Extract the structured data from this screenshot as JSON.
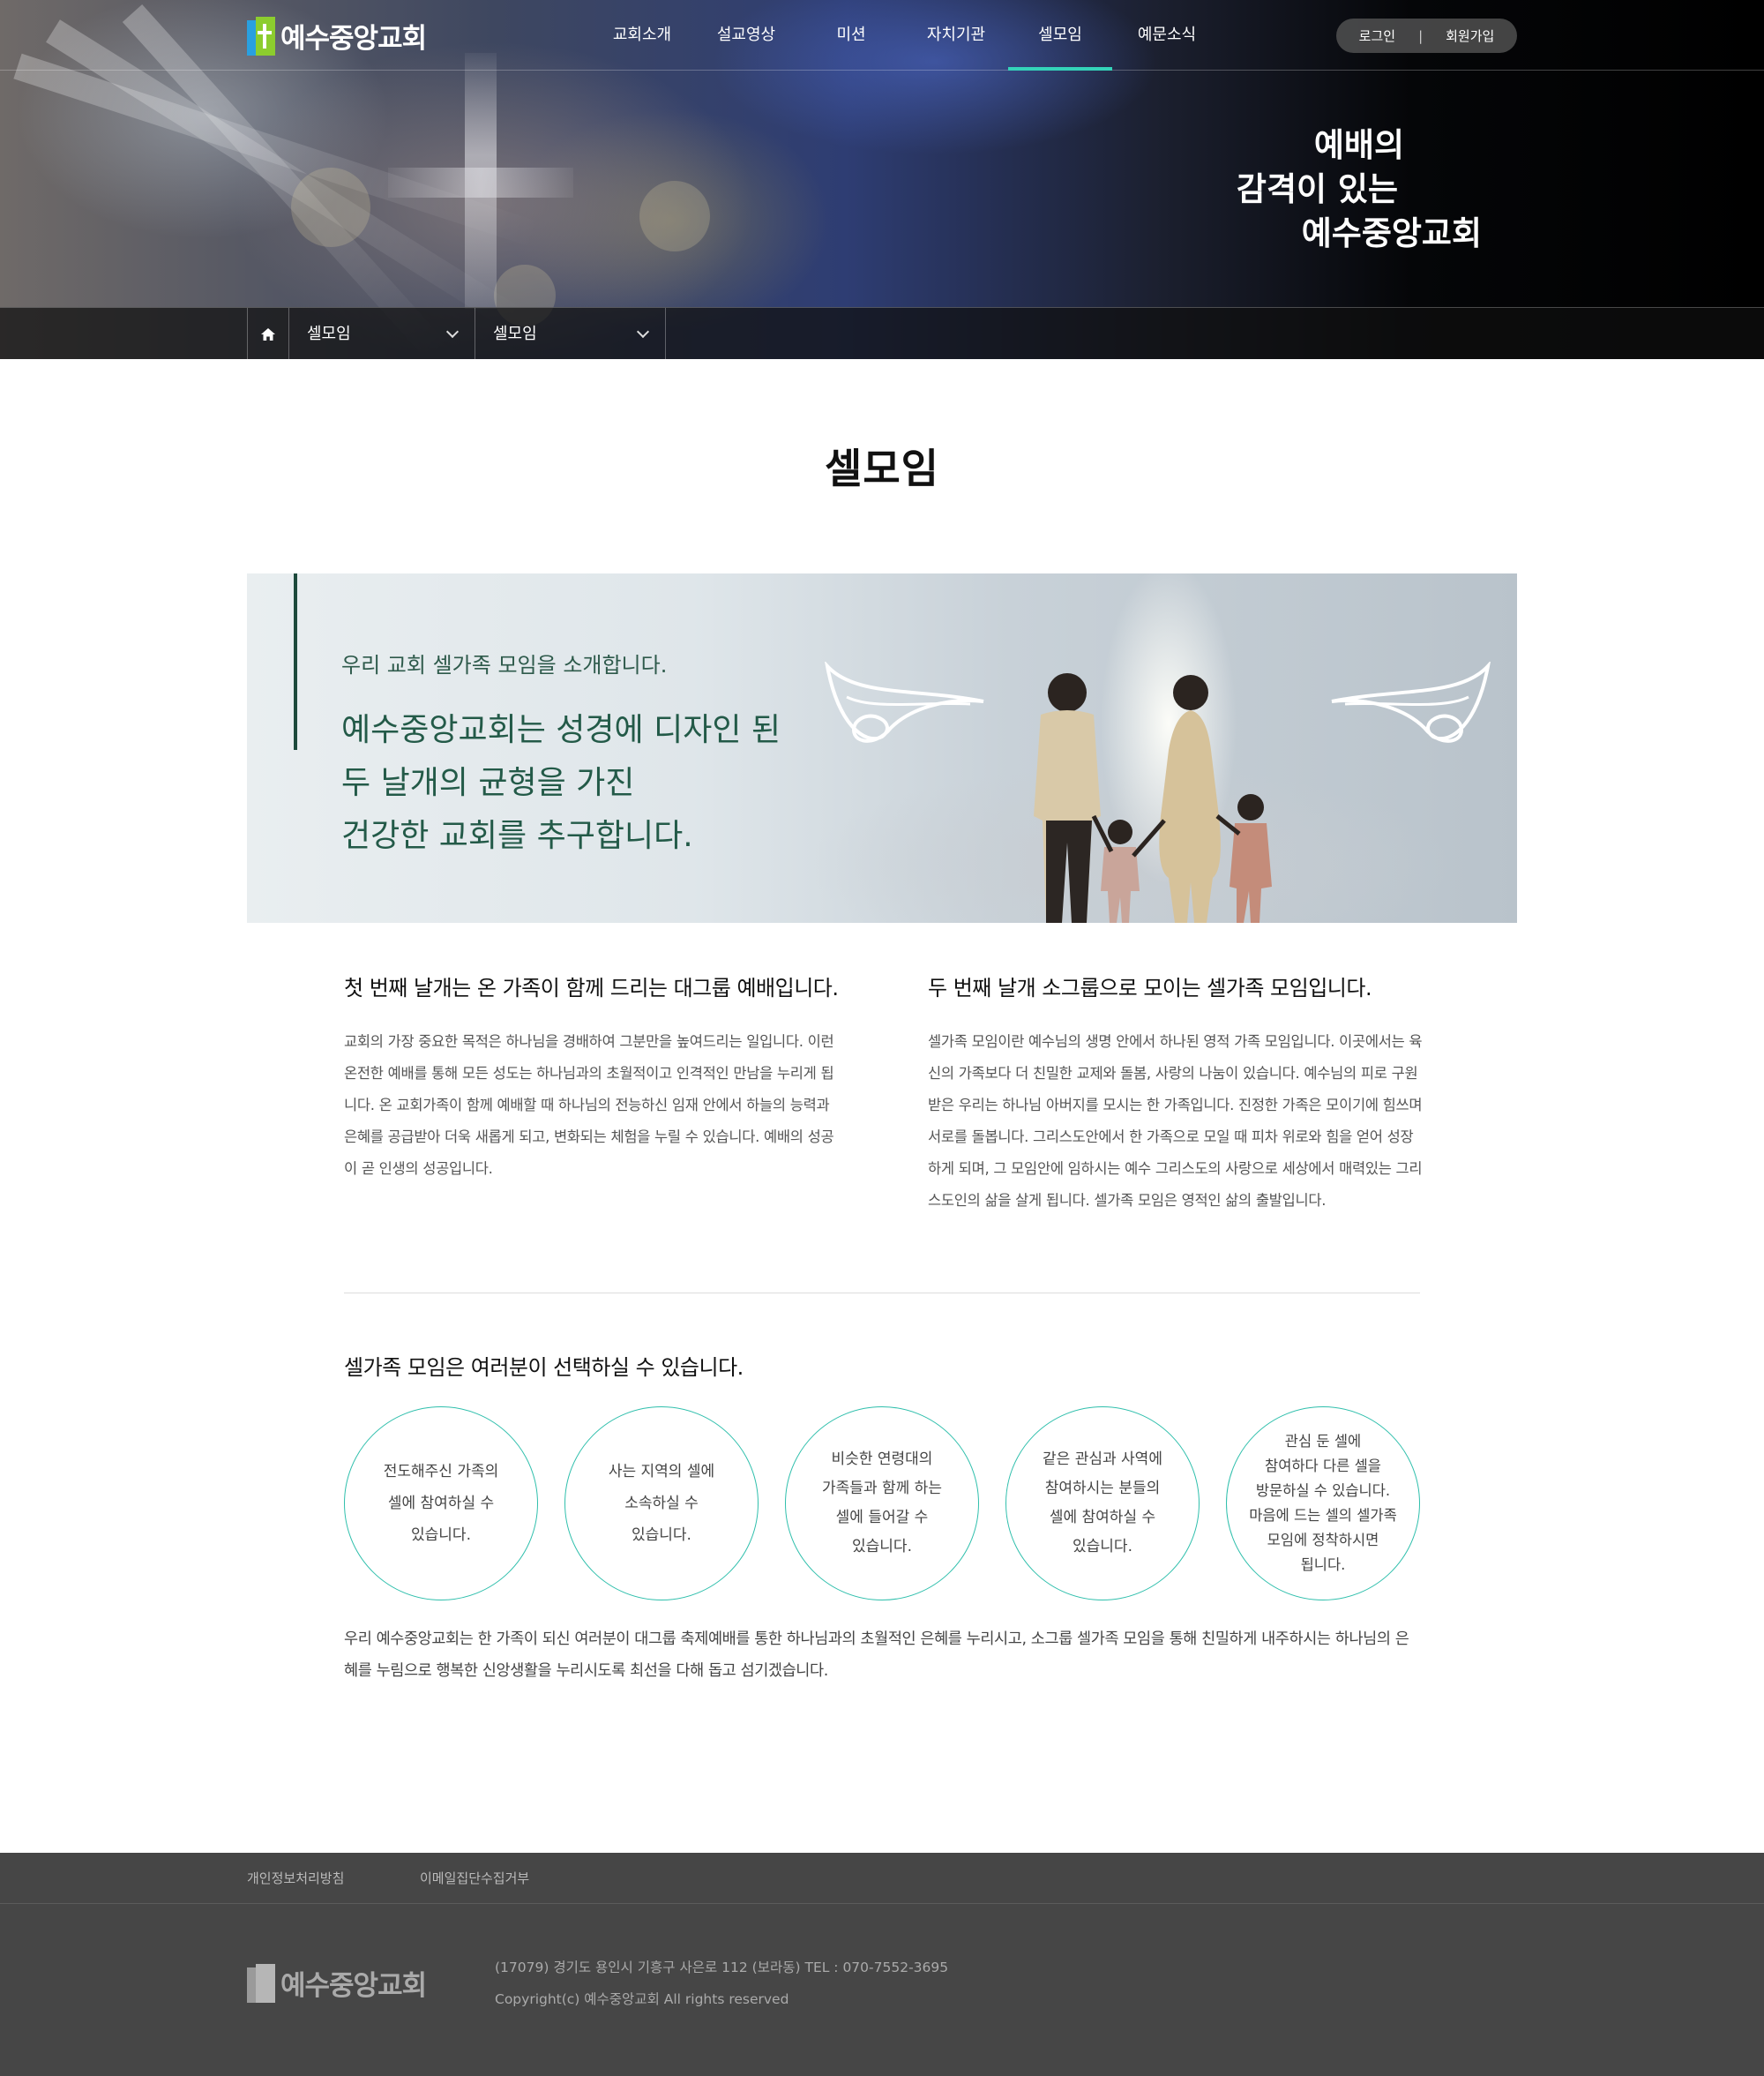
{
  "site": {
    "logo_text": "예수중앙교회"
  },
  "nav": {
    "items": [
      "교회소개",
      "설교영상",
      "미션",
      "자치기관",
      "셀모임",
      "예문소식"
    ],
    "active_index": 4,
    "accent_color": "#34d3b9"
  },
  "auth": {
    "login": "로그인",
    "separator": "|",
    "signup": "회원가입"
  },
  "hero": {
    "slogan": [
      "예배의",
      "감격이 있는",
      "예수중앙교회"
    ]
  },
  "location": {
    "home_icon": "home-icon",
    "select1": "셀모임",
    "select2": "셀모임"
  },
  "page": {
    "title": "셀모임"
  },
  "banner": {
    "subtitle": "우리 교회 셀가족 모임을 소개합니다.",
    "lines": [
      "예수중앙교회는 성경에 디자인 된",
      "두 날개의 균형을 가진",
      "건강한 교회를 추구합니다."
    ]
  },
  "wings": {
    "first": {
      "title": "첫 번째 날개는 온 가족이 함께 드리는 대그룹 예배입니다.",
      "body": "교회의 가장 중요한 목적은 하나님을 경배하여 그분만을 높여드리는 일입니다. 이런 온전한 예배를 통해 모든 성도는 하나님과의 초월적이고 인격적인 만남을 누리게 됩니다. 온 교회가족이 함께 예배할 때 하나님의 전능하신 임재 안에서 하늘의 능력과 은혜를 공급받아 더욱 새롭게 되고, 변화되는 체험을 누릴 수 있습니다. 예배의 성공이 곧 인생의 성공입니다."
    },
    "second": {
      "title": "두 번째 날개 소그룹으로 모이는 셀가족 모임입니다.",
      "body": "셀가족 모임이란 예수님의 생명 안에서 하나된 영적 가족 모임입니다. 이곳에서는 육신의 가족보다 더 친밀한 교제와 돌봄, 사랑의 나눔이 있습니다. 예수님의 피로 구원받은 우리는 하나님 아버지를 모시는 한 가족입니다. 진정한 가족은 모이기에 힘쓰며 서로를 돌봅니다. 그리스도안에서 한 가족으로 모일 때 피차 위로와 힘을 얻어 성장하게 되며, 그 모임안에 임하시는 예수 그리스도의 사랑으로 세상에서 매력있는 그리스도인의 삶을 살게 됩니다. 셀가족 모임은 영적인 삶의 출발입니다."
    }
  },
  "choices": {
    "title": "셀가족 모임은 여러분이 선택하실 수 있습니다.",
    "items": [
      [
        "전도해주신 가족의",
        "셀에 참여하실 수",
        "있습니다."
      ],
      [
        "사는 지역의 셀에",
        "소속하실 수",
        "있습니다."
      ],
      [
        "비슷한 연령대의",
        "가족들과 함께 하는",
        "셀에 들어갈 수",
        "있습니다."
      ],
      [
        "같은 관심과 사역에",
        "참여하시는 분들의",
        "셀에 참여하실 수",
        "있습니다."
      ],
      [
        "관심 둔 셀에",
        "참여하다 다른 셀을",
        "방문하실 수 있습니다.",
        "마음에 드는 셀의 셀가족",
        "모임에 정착하시면",
        "됩니다."
      ]
    ],
    "closing": "우리 예수중앙교회는 한 가족이 되신 여러분이 대그룹 축제예배를 통한 하나님과의 초월적인 은혜를 누리시고, 소그룹 셀가족 모임을 통해 친밀하게 내주하시는 하나님의 은혜를 누림으로 행복한 신앙생활을 누리시도록 최선을 다해 돕고 섬기겠습니다."
  },
  "footer": {
    "links": [
      "개인정보처리방침",
      "이메일집단수집거부"
    ],
    "logo_text": "예수중앙교회",
    "address": "(17079) 경기도 용인시 기흥구 사은로 112 (보라동)    TEL : 070-7552-3695",
    "copyright": "Copyright(c) 예수중앙교회 All rights reserved"
  }
}
